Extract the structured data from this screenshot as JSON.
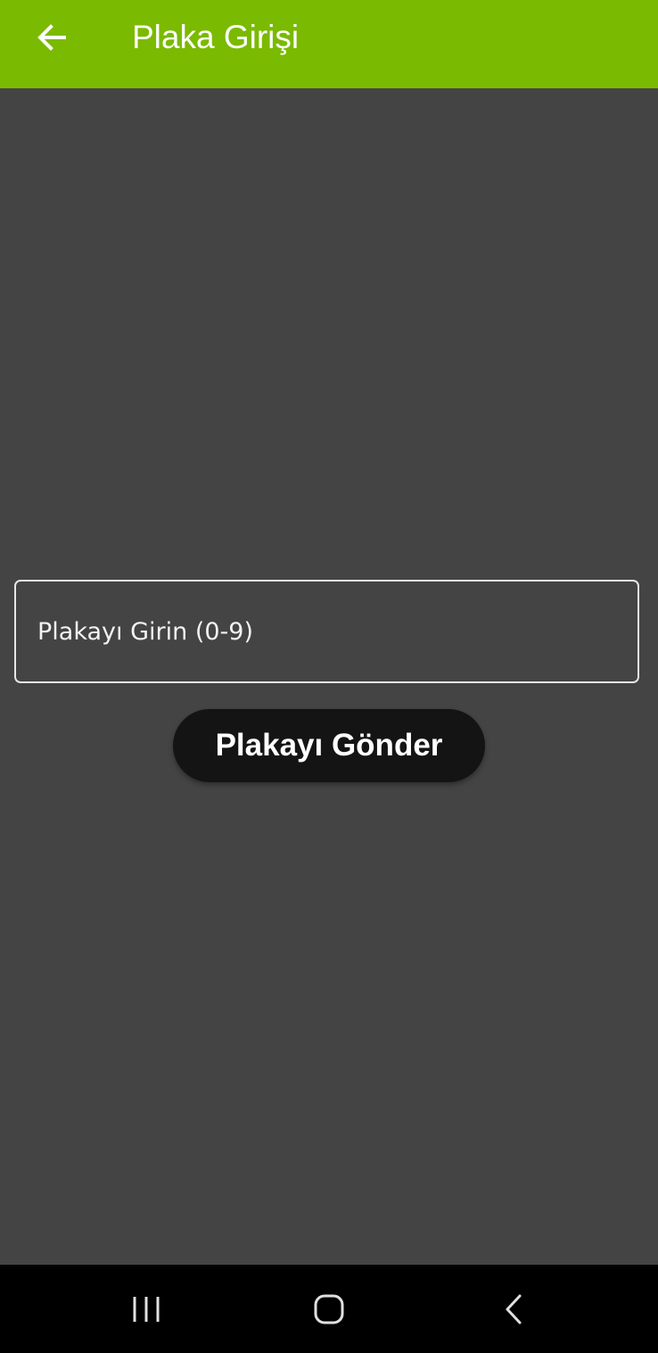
{
  "app_bar": {
    "title": "Plaka Girişi",
    "back_icon": "arrow-left-icon",
    "background_color": "#7aba00"
  },
  "form": {
    "plate_input_placeholder": "Plakayı Girin (0-9)",
    "plate_input_value": "",
    "submit_label": "Plakayı Gönder"
  },
  "system_nav": {
    "recent_icon": "recent-apps-icon",
    "home_icon": "home-icon",
    "back_icon": "back-chevron-icon"
  },
  "colors": {
    "background": "#444444",
    "button": "#141414",
    "nav_bar": "#000000"
  }
}
